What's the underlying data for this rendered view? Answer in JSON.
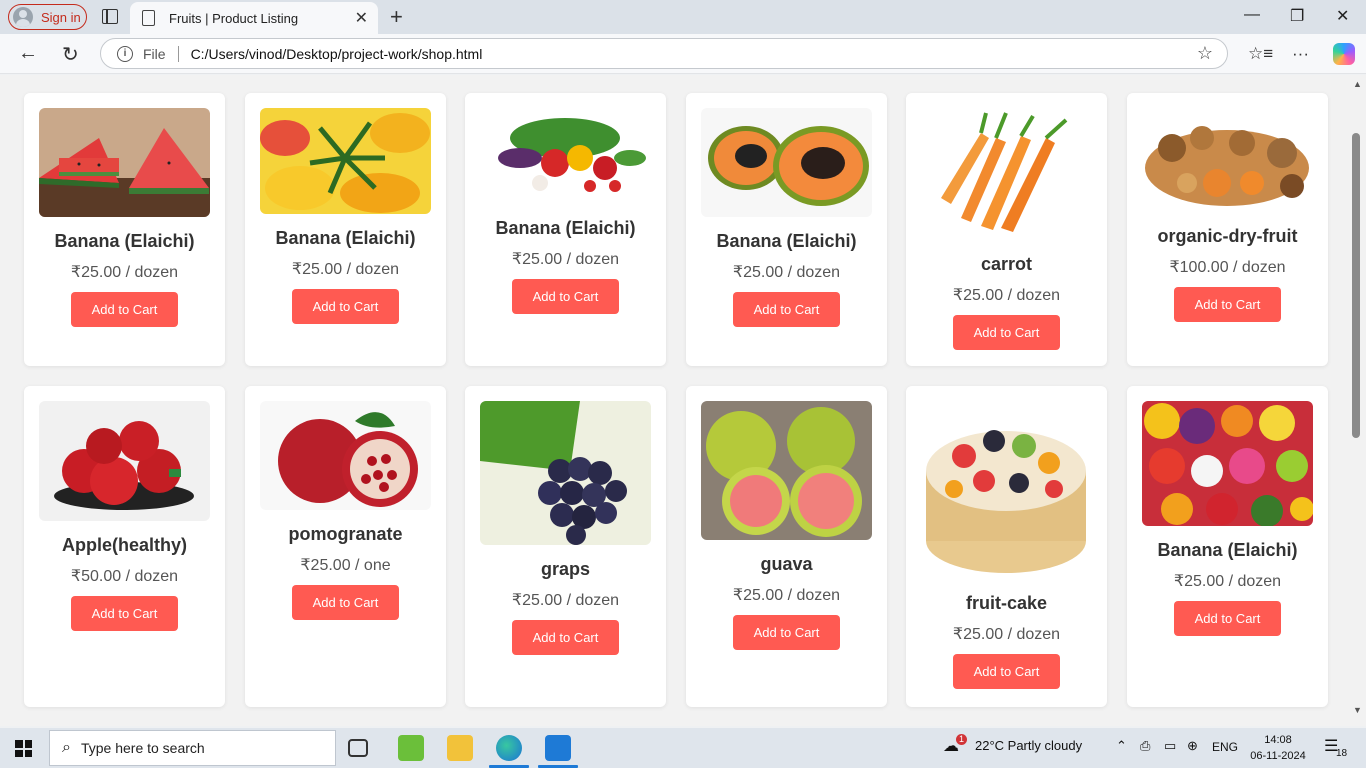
{
  "browser": {
    "signin_label": "Sign in",
    "tab_title": "Fruits | Product Listing",
    "protocol_label": "File",
    "url": "C:/Users/vinod/Desktop/project-work/shop.html"
  },
  "products": [
    {
      "name": "Banana (Elaichi)",
      "price": "₹25.00 / dozen",
      "button": "Add to Cart",
      "image": "watermelon"
    },
    {
      "name": "Banana (Elaichi)",
      "price": "₹25.00 / dozen",
      "button": "Add to Cart",
      "image": "mango"
    },
    {
      "name": "Banana (Elaichi)",
      "price": "₹25.00 / dozen",
      "button": "Add to Cart",
      "image": "vegetables"
    },
    {
      "name": "Banana (Elaichi)",
      "price": "₹25.00 / dozen",
      "button": "Add to Cart",
      "image": "papaya"
    },
    {
      "name": "carrot",
      "price": "₹25.00 / dozen",
      "button": "Add to Cart",
      "image": "carrot"
    },
    {
      "name": "organic-dry-fruit",
      "price": "₹100.00 / dozen",
      "button": "Add to Cart",
      "image": "dry-fruits"
    },
    {
      "name": "Apple(healthy)",
      "price": "₹50.00 / dozen",
      "button": "Add to Cart",
      "image": "apples"
    },
    {
      "name": "pomogranate",
      "price": "₹25.00 / one",
      "button": "Add to Cart",
      "image": "pomegranate"
    },
    {
      "name": "graps",
      "price": "₹25.00 / dozen",
      "button": "Add to Cart",
      "image": "grapes"
    },
    {
      "name": "guava",
      "price": "₹25.00 / dozen",
      "button": "Add to Cart",
      "image": "guava"
    },
    {
      "name": "fruit-cake",
      "price": "₹25.00 / dozen",
      "button": "Add to Cart",
      "image": "fruit-cake"
    },
    {
      "name": "Banana (Elaichi)",
      "price": "₹25.00 / dozen",
      "button": "Add to Cart",
      "image": "mixed-fruits"
    }
  ],
  "taskbar": {
    "search_placeholder": "Type here to search",
    "weather": "22°C  Partly cloudy",
    "weather_badge": "1",
    "language": "ENG",
    "time": "14:08",
    "date": "06-11-2024",
    "notification_count": "18"
  },
  "colors": {
    "button": "#ff5a52",
    "page_bg": "#f2f2f2",
    "card_bg": "#ffffff"
  }
}
